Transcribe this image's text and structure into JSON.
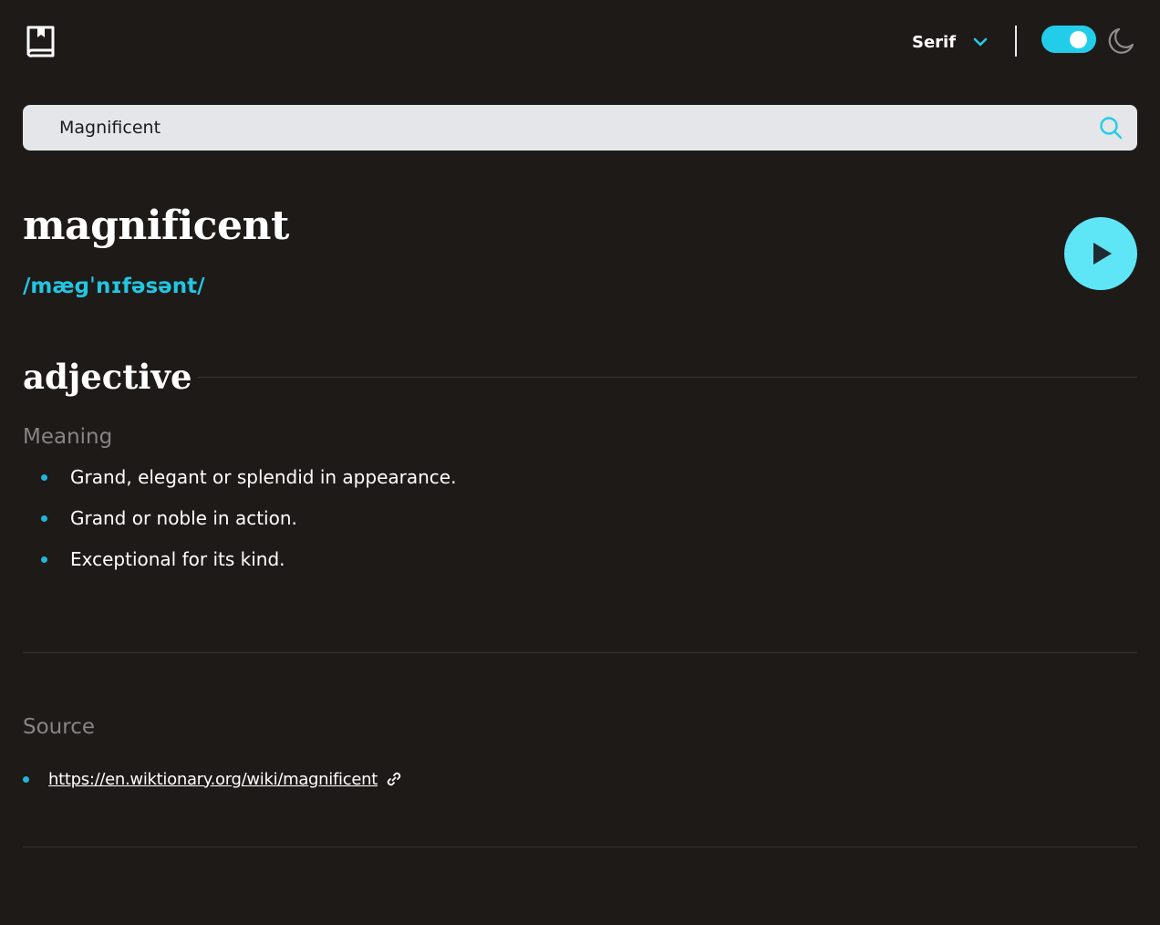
{
  "header": {
    "logo_icon": "book-icon",
    "font_select": {
      "selected": "Serif",
      "icon": "chevron-down-icon"
    },
    "theme_toggle": {
      "state": "on",
      "icon": "moon-icon"
    }
  },
  "search": {
    "value": "Magnificent",
    "icon": "search-icon"
  },
  "entry": {
    "word": "magnificent",
    "phonetic": "/mæɡˈnɪfəsənt/",
    "play_icon": "play-icon",
    "part_of_speech": "adjective",
    "meaning_label": "Meaning",
    "definitions": [
      "Grand, elegant or splendid in appearance.",
      "Grand or noble in action.",
      "Exceptional for its kind."
    ]
  },
  "source": {
    "label": "Source",
    "url": "https://en.wiktionary.org/wiki/magnificent",
    "icon": "external-link-icon"
  },
  "colors": {
    "background": "#1e1a18",
    "accent": "#22cde9",
    "play_button": "#5ee6f6",
    "search_bg": "#e5e6ea",
    "muted_text": "#858585"
  }
}
